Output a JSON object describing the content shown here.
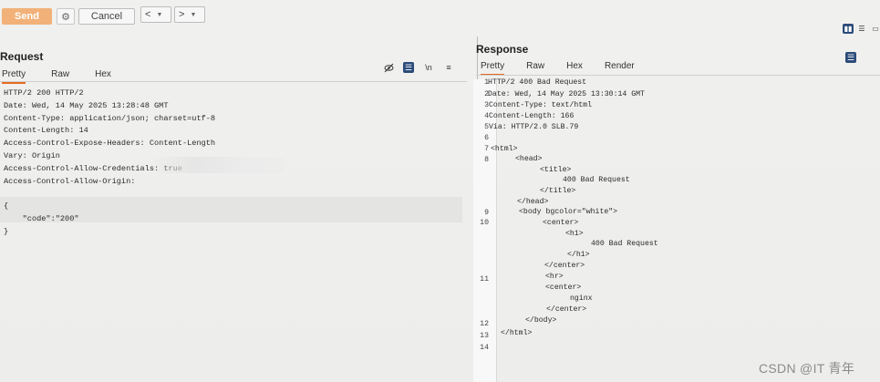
{
  "toolbar": {
    "send_label": "Send",
    "cancel_label": "Cancel",
    "back_label": "<",
    "forward_label": ">",
    "dropdown_glyph": "▼"
  },
  "request": {
    "title": "Request",
    "tabs": [
      "Pretty",
      "Raw",
      "Hex"
    ],
    "active_tab": "Pretty",
    "lines": [
      "HTTP/2 200 HTTP/2",
      "Date: Wed, 14 May 2025 13:28:48 GMT",
      "Content-Type: application/json; charset=utf-8",
      "Content-Length: 14",
      "Access-Control-Expose-Headers: Content-Length",
      "Vary: Origin",
      "Access-Control-Allow-Credentials: true",
      "Access-Control-Allow-Origin:",
      "",
      "{",
      "    \"code\":\"200\"",
      "}"
    ]
  },
  "response": {
    "title": "Response",
    "tabs": [
      "Pretty",
      "Raw",
      "Hex",
      "Render"
    ],
    "active_tab": "Pretty",
    "line_numbers": [
      "1",
      "2",
      "3",
      "4",
      "5",
      "6",
      "7",
      "8",
      "9",
      "10",
      "11",
      "12",
      "13",
      "14"
    ],
    "lines": [
      "HTTP/2 400 Bad Request",
      "Date: Wed, 14 May 2025 13:30:14 GMT",
      "Content-Type: text/html",
      "Content-Length: 166",
      "Via: HTTP/2.0 SLB.79",
      "",
      "<html>",
      "<head>",
      "<title>",
      "400 Bad Request",
      "</title>",
      "</head>",
      "<body bgcolor=\"white\">",
      "<center>",
      "<h1>",
      "400 Bad Request",
      "</h1>",
      "</center>",
      "<hr>",
      "<center>",
      "nginx",
      "</center>",
      "</body>",
      "</html>"
    ]
  },
  "icons": {
    "gear": "gear-icon",
    "hide": "eye-slash-icon",
    "wrap": "wrap-icon",
    "newline": "newline-icon",
    "menu": "menu-icon",
    "layout_split": "split-vertical-icon",
    "layout_stack": "split-horizontal-icon"
  },
  "icon_text": {
    "newline": "\\n",
    "menu": "≡",
    "gear": "⚙",
    "wrap": "☰"
  },
  "colors": {
    "send": "#f1b178",
    "accent": "#e56b1f",
    "active_icon": "#2b4c7a"
  },
  "watermark": "CSDN @IT 青年"
}
